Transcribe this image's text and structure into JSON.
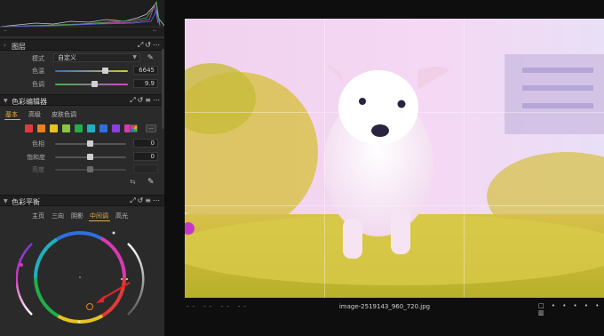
{
  "histogram": {
    "left_marker": "--",
    "right_marker": "--"
  },
  "layers": {
    "title": "图层",
    "mode_label": "模式",
    "mode_value": "自定义",
    "rows": [
      {
        "label": "色温",
        "value": "6645",
        "level": 0.86
      },
      {
        "label": "色调",
        "value": "9.9",
        "level": 0.71
      }
    ]
  },
  "color_editor": {
    "title": "色彩编辑器",
    "tabs": [
      "基本",
      "高级",
      "皮肤色调"
    ],
    "active_tab": "基本",
    "swatches": [
      "#e23a3a",
      "#e8801e",
      "#e8c320",
      "#8bc53f",
      "#1fae4b",
      "#1fb0c0",
      "#2f6fe0",
      "#8a3fe0",
      "#d93ab0",
      "multi-icon"
    ],
    "more_label": "...",
    "rows": [
      {
        "label": "色相",
        "value": "0",
        "level": 0.5
      },
      {
        "label": "饱和度",
        "value": "0",
        "level": 0.5
      },
      {
        "label": "亮度",
        "value": "",
        "level": 0.5
      }
    ]
  },
  "color_balance": {
    "title": "色彩平衡",
    "tabs": [
      "主页",
      "三向",
      "阴影",
      "中间调",
      "高光"
    ],
    "active_tab": "中间调"
  },
  "viewer": {
    "filename": "image-2519143_960_720.jpg",
    "meta": "-- -- -- --"
  }
}
